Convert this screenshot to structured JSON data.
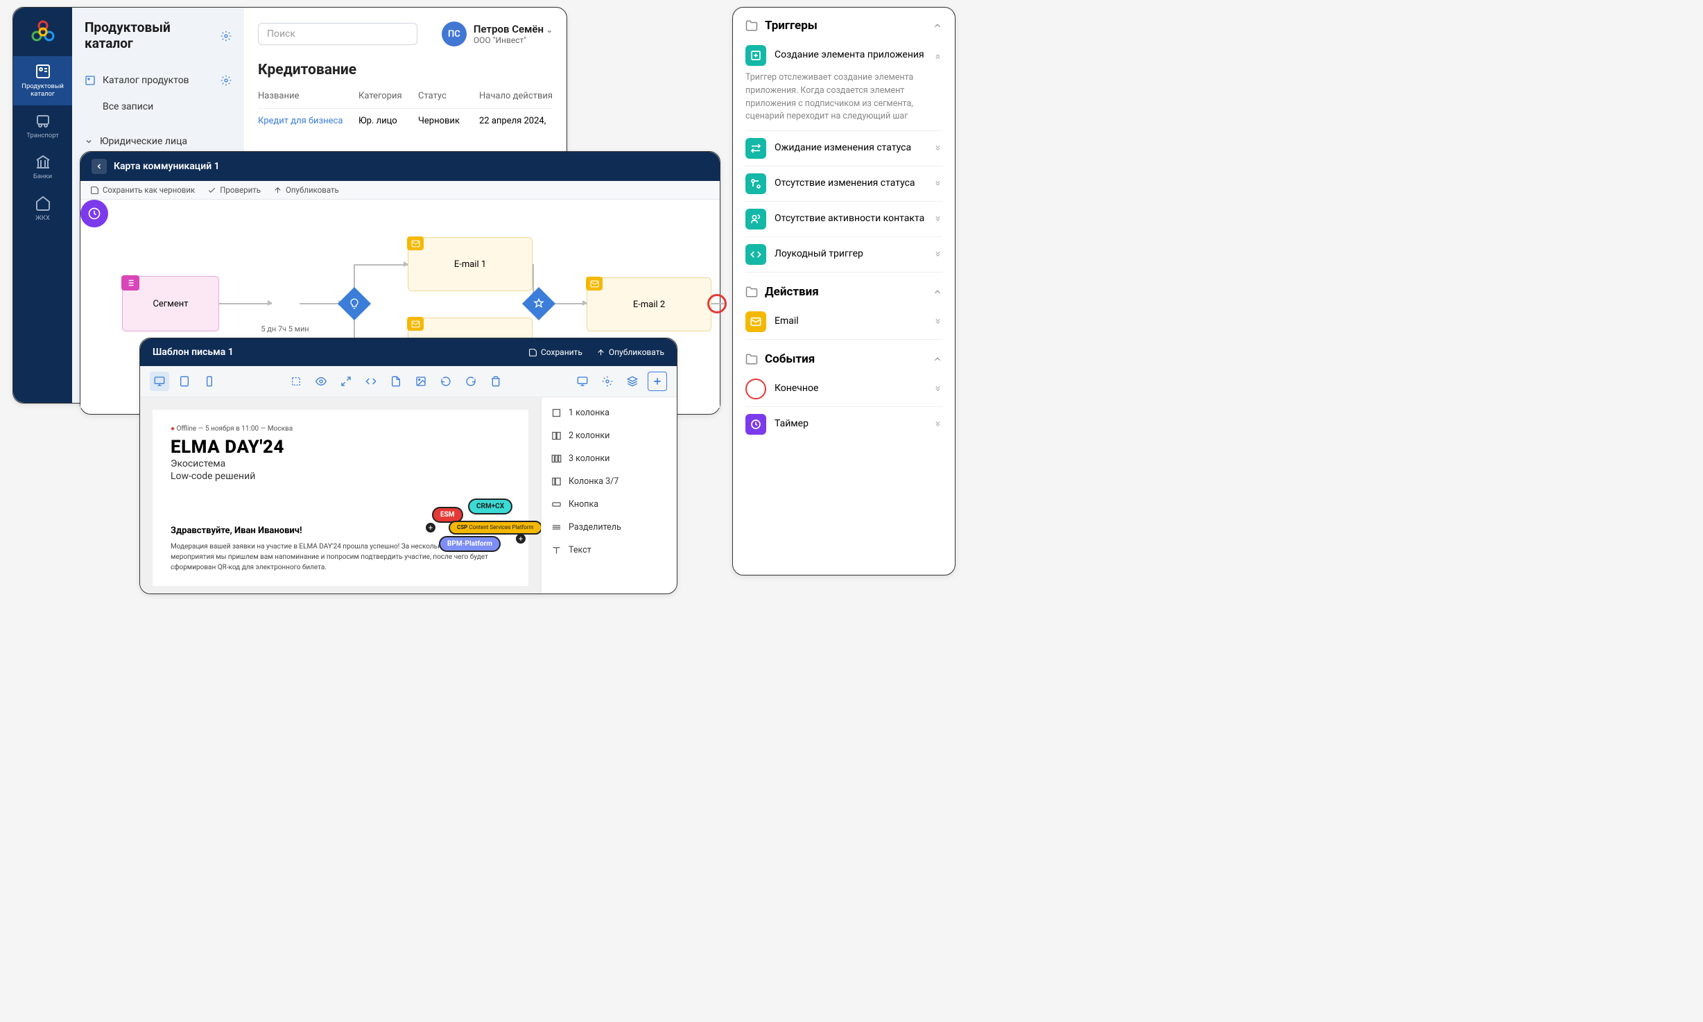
{
  "p1": {
    "title": "Продуктовый каталог",
    "rail": [
      {
        "label": "Продуктовый каталог",
        "active": true
      },
      {
        "label": "Транспорт"
      },
      {
        "label": "Банки"
      },
      {
        "label": "ЖКХ"
      }
    ],
    "side": {
      "catalog": "Каталог продуктов",
      "all": "Все записи",
      "legal": "Юридические лица"
    },
    "search_ph": "Поиск",
    "user": {
      "initials": "ПС",
      "name": "Петров Семён",
      "company": "ООО \"Инвест\""
    },
    "h1": "Кредитование",
    "cols": [
      "Название",
      "Категория",
      "Статус",
      "Начало действия"
    ],
    "row": [
      "Кредит для бизнеса",
      "Юр. лицо",
      "Черновик",
      "22 апреля 2024,"
    ]
  },
  "p2": {
    "title": "Карта коммуникаций 1",
    "tb": {
      "draft": "Сохранить как черновик",
      "check": "Проверить",
      "publish": "Опубликовать"
    },
    "segment": "Сегмент",
    "timer": "5 дн 7ч 5 мин",
    "email1": "E-mail 1",
    "email2": "E-mail 2"
  },
  "p3": {
    "title": "Шаблон письма 1",
    "save": "Сохранить",
    "publish": "Опубликовать",
    "meta": "Offline — 5 ноября в 11:00 — Москва",
    "h": "ELMA DAY'24",
    "sub1": "Экосистема",
    "sub2": "Low-code решений",
    "greeting": "Здравствуйте, Иван Иванович!",
    "body": "Модерация вашей заявки на участие в ELMA DAY'24 прошла успешно! За несколько дней до мероприятия мы пришлем вам напоминание и попросим подтвердить участие, после чего будет сформирован QR-код для электронного билета.",
    "badges": {
      "esm": "ESM",
      "crm": "CRM+CX",
      "csp": "CSP",
      "csp2": "Content Services Platform",
      "bpm": "BPM-Platform"
    },
    "widgets": [
      "1 колонка",
      "2 колонки",
      "3 колонки",
      "Колонка 3/7",
      "Кнопка",
      "Разделитель",
      "Текст"
    ]
  },
  "p4": {
    "sec1": "Триггеры",
    "t1": {
      "name": "Создание элемента приложения",
      "desc": "Триггер отслеживает создание элемента приложения. Когда создается элемент приложения с подписчиком из сегмента, сценарий переходит на следующий шаг"
    },
    "t2": "Ожидание  изменения статуса",
    "t3": "Отсутствие изменения статуса",
    "t4": "Отсутствие активности контакта",
    "t5": "Лоукодный триггер",
    "sec2": "Действия",
    "a1": "Email",
    "sec3": "События",
    "e1": "Конечное",
    "e2": "Таймер"
  }
}
